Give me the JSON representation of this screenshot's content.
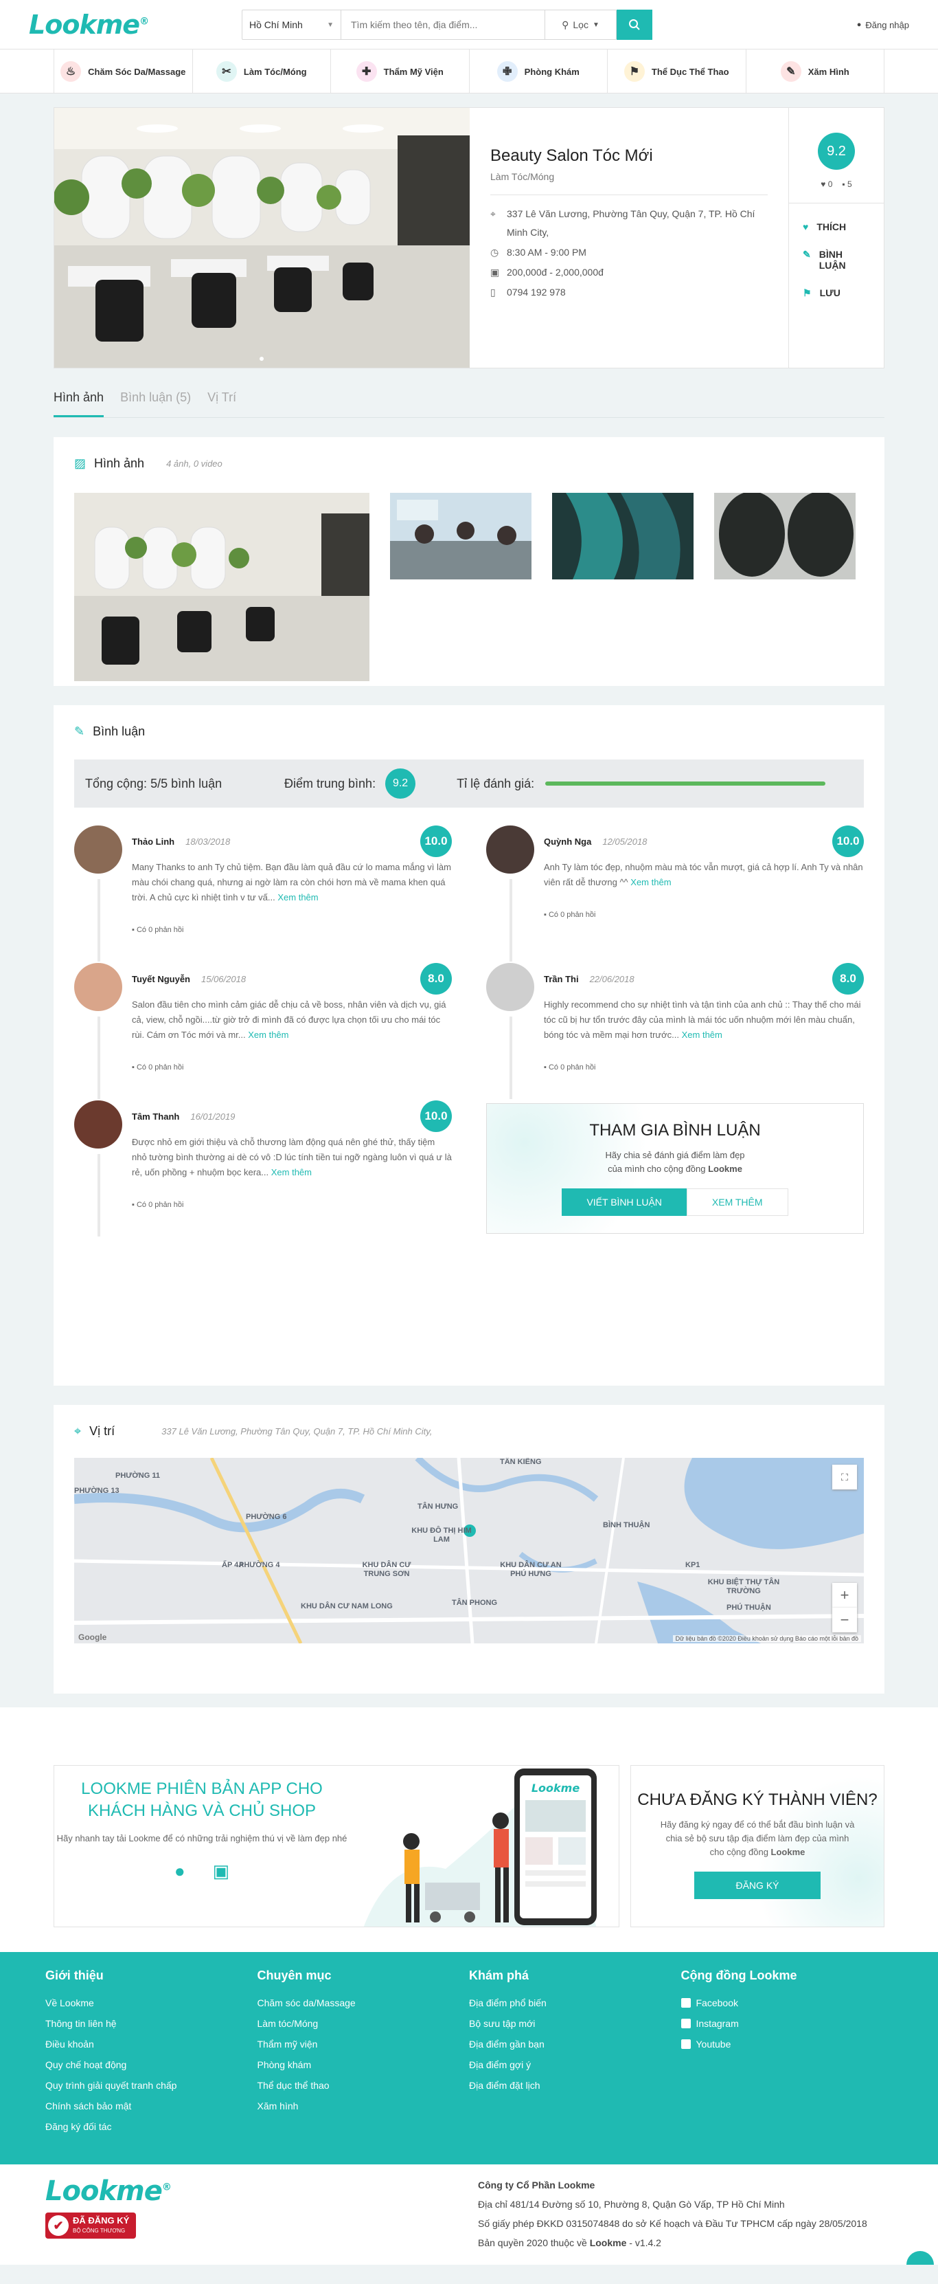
{
  "header": {
    "city": "Hồ Chí Minh",
    "search_placeholder": "Tìm kiếm theo tên, địa điểm...",
    "filter_label": "Lọc",
    "login_label": "Đăng nhập"
  },
  "categories": [
    {
      "label": "Chăm Sóc Da/Massage",
      "icon": "spa-icon",
      "color": "#fde3e3",
      "glyph": "♨"
    },
    {
      "label": "Làm Tóc/Móng",
      "icon": "hair-salon-icon",
      "color": "#e0f5f4",
      "glyph": "✂"
    },
    {
      "label": "Thẩm Mỹ Viện",
      "icon": "beauty-clinic-icon",
      "color": "#fbe3f1",
      "glyph": "✚"
    },
    {
      "label": "Phòng Khám",
      "icon": "clinic-icon",
      "color": "#e2eefb",
      "glyph": "✙"
    },
    {
      "label": "Thể Dục Thể Thao",
      "icon": "fitness-icon",
      "color": "#fff3d6",
      "glyph": "⚑"
    },
    {
      "label": "Xăm Hình",
      "icon": "tattoo-icon",
      "color": "#fde3e3",
      "glyph": "✎"
    }
  ],
  "place": {
    "name": "Beauty Salon Tóc Mới",
    "category": "Làm Tóc/Móng",
    "address": "337 Lê Văn Lương, Phường Tân Quy, Quận 7, TP. Hồ Chí Minh City,",
    "hours": "8:30 AM - 9:00 PM",
    "price": "200,000đ - 2,000,000đ",
    "phone": "0794 192 978",
    "score": "9.2",
    "likes": "0",
    "comments": "5"
  },
  "actions": {
    "like": "THÍCH",
    "comment": "BÌNH LUẬN",
    "save": "LƯU"
  },
  "tabs": [
    "Hình ảnh",
    "Bình luận (5)",
    "Vị Trí"
  ],
  "photos": {
    "title": "Hình ảnh",
    "count": "4 ảnh, 0 video"
  },
  "comments": {
    "title": "Bình luận",
    "total": "Tổng cộng: 5/5 bình luận",
    "avg_label": "Điểm trung bình:",
    "avg": "9.2",
    "rate_label": "Tỉ lệ đánh giá:",
    "rate_fraction": 1.0,
    "more": "Xem thêm",
    "items": [
      {
        "name": "Thảo Linh",
        "date": "18/03/2018",
        "score": "10.0",
        "text": "Many Thanks to anh Ty chủ tiệm. Bạn đầu làm quả đầu cứ lo mama mắng vì làm màu chói chang quá, nhưng ai ngờ làm ra còn chói hơn mà về mama khen quá trời. A chủ cực kì nhiệt tình v tư vấ...",
        "replies": "Có 0 phản hồi",
        "avatar": "#8a6a55"
      },
      {
        "name": "Quỳnh Nga",
        "date": "12/05/2018",
        "score": "10.0",
        "text": "Anh Ty làm tóc đẹp, nhuộm màu mà tóc vẫn mượt, giá cả hợp lí. Anh Ty và nhân viên rất dễ thương ^^",
        "replies": "Có 0 phản hồi",
        "avatar": "#4a3a36"
      },
      {
        "name": "Tuyết Nguyễn",
        "date": "15/06/2018",
        "score": "8.0",
        "text": "Salon đầu tiên cho mình cảm giác dễ chịu cả về boss, nhân viên và dịch vụ, giá cả, view, chỗ ngồi....từ giờ trở đi mình đã có được lựa chọn tối ưu cho mái tóc rùi. Cám ơn Tóc mới và mr...",
        "replies": "Có 0 phản hồi",
        "avatar": "#d9a58a"
      },
      {
        "name": "Trần Thi",
        "date": "22/06/2018",
        "score": "8.0",
        "text": "Highly recommend cho sự nhiệt tình và tận tình của anh chủ :: Thay thế cho mái tóc cũ bị hư tổn trước đây của mình là mái tóc uốn nhuộm mới lên màu chuẩn, bóng tóc và mềm mại hơn trước...",
        "replies": "Có 0 phản hồi",
        "avatar": "#cfcfcf"
      },
      {
        "name": "Tâm Thanh",
        "date": "16/01/2019",
        "score": "10.0",
        "text": "Được nhỏ em giới thiệu và chỗ thương làm động quá nên ghé thử, thấy tiệm nhỏ tường bình thường ai dè có vô :D lúc tính tiền tui ngỡ ngàng luôn vì quá ư là rẻ, uốn phồng + nhuộm bọc kera...",
        "replies": "Có 0 phản hồi",
        "avatar": "#6b3a2e"
      }
    ]
  },
  "join": {
    "title": "THAM GIA BÌNH LUẬN",
    "text_1": "Hãy chia sẻ đánh giá điểm làm đẹp của mình cho cộng đồng ",
    "brand": "Lookme",
    "write": "VIẾT BÌNH LUẬN",
    "view": "XEM THÊM"
  },
  "location": {
    "title": "Vị trí",
    "address": "337 Lê Văn Lương, Phường Tân Quy, Quận 7, TP. Hồ Chí Minh City,",
    "labels": [
      "PHƯỜNG 11",
      "PHƯỜNG 13",
      "PHƯỜNG 6",
      "PHƯỜNG 4",
      "TÂN HƯNG",
      "TÂN KIỂNG",
      "KHU ĐÔ THỊ HIM LAM",
      "BÌNH THUẬN",
      "KHU DÂN CƯ TRUNG SƠN",
      "KHU DÂN CƯ AN PHÚ HƯNG",
      "ẤP 4A",
      "TÂN PHONG",
      "KHU DÂN CƯ NAM LONG",
      "KP1",
      "KHU BIỆT THỰ TÂN TRƯỜNG",
      "PHÚ THUẬN"
    ],
    "credit": "Dữ liệu bản đồ ©2020   Điều khoản sử dụng   Báo cáo một lỗi bản đồ",
    "google": "Google"
  },
  "promo": {
    "app_title": "LOOKME PHIÊN BẢN APP CHO KHÁCH HÀNG VÀ CHỦ SHOP",
    "app_text": "Hãy nhanh tay tải Lookme để có những trải nghiệm thú vị về làm đẹp nhé",
    "phone_brand": "Lookme",
    "reg_title": "CHƯA ĐĂNG KÝ THÀNH VIÊN?",
    "reg_text": "Hãy đăng ký ngay để có thể bắt đầu bình luận và chia sẻ bộ sưu tập địa điểm làm đẹp của mình cho cộng đồng ",
    "reg_brand": "Lookme",
    "reg_btn": "ĐĂNG KÝ"
  },
  "footer": {
    "cols": [
      {
        "title": "Giới thiệu",
        "items": [
          "Về Lookme",
          "Thông tin liên hệ",
          "Điều khoản",
          "Quy chế hoạt động",
          "Quy trình giải quyết tranh chấp",
          "Chính sách bảo mật",
          "Đăng ký đối tác"
        ]
      },
      {
        "title": "Chuyên mục",
        "items": [
          "Chăm sóc da/Massage",
          "Làm tóc/Móng",
          "Thẩm mỹ viện",
          "Phòng khám",
          "Thể dục thể thao",
          "Xăm hình"
        ]
      },
      {
        "title": "Khám phá",
        "items": [
          "Địa điểm phổ biến",
          "Bộ sưu tập mới",
          "Địa điểm gần bạn",
          "Địa điểm gợi ý",
          "Địa điểm đặt lịch"
        ]
      },
      {
        "title": "Cộng đồng Lookme",
        "items": [
          "Facebook",
          "Instagram",
          "Youtube"
        ]
      }
    ],
    "company": "Công ty Cổ Phần Lookme",
    "address": "Địa chỉ 481/14 Đường số 10, Phường 8, Quận Gò Vấp, TP Hồ Chí Minh",
    "license": "Số giấy phép ĐKKD 0315074848 do sở Kế hoạch và Đầu Tư TPHCM cấp ngày 28/05/2018",
    "copyright_pre": "Bản quyền 2020 thuộc về ",
    "copyright_brand": "Lookme",
    "version": " - v1.4.2",
    "badge_main": "ĐÃ ĐĂNG KÝ",
    "badge_sub": "BỘ CÔNG THƯƠNG",
    "logo": "Lookme"
  }
}
